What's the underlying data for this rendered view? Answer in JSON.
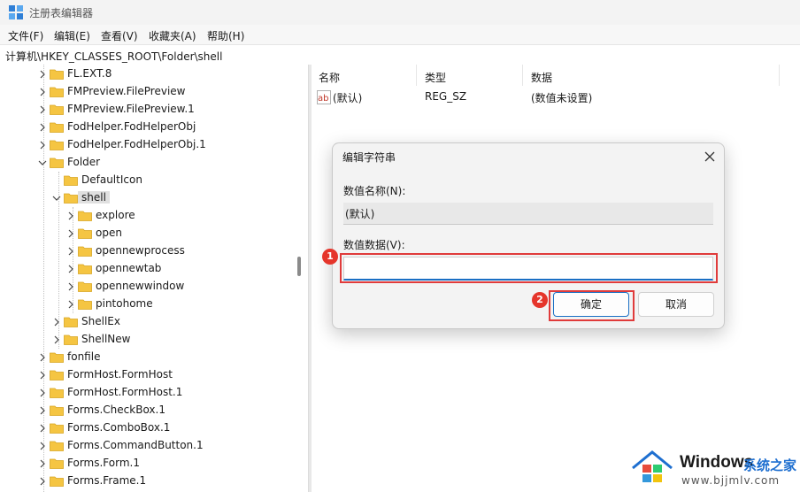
{
  "window": {
    "title": "注册表编辑器"
  },
  "menu": [
    {
      "id": "file",
      "label": "文件(F)"
    },
    {
      "id": "edit",
      "label": "编辑(E)"
    },
    {
      "id": "view",
      "label": "查看(V)"
    },
    {
      "id": "favorites",
      "label": "收藏夹(A)"
    },
    {
      "id": "help",
      "label": "帮助(H)"
    }
  ],
  "address": {
    "path": "计算机\\HKEY_CLASSES_ROOT\\Folder\\shell"
  },
  "tree": {
    "items": [
      {
        "label": "FL.EXT.8",
        "state": "collapsed"
      },
      {
        "label": "FMPreview.FilePreview",
        "state": "collapsed"
      },
      {
        "label": "FMPreview.FilePreview.1",
        "state": "collapsed"
      },
      {
        "label": "FodHelper.FodHelperObj",
        "state": "collapsed"
      },
      {
        "label": "FodHelper.FodHelperObj.1",
        "state": "collapsed"
      },
      {
        "label": "Folder",
        "state": "expanded"
      },
      {
        "label": "DefaultIcon",
        "state": "leaf"
      },
      {
        "label": "shell",
        "state": "expanded",
        "selected": true
      },
      {
        "label": "explore",
        "state": "collapsed"
      },
      {
        "label": "open",
        "state": "collapsed"
      },
      {
        "label": "opennewprocess",
        "state": "collapsed"
      },
      {
        "label": "opennewtab",
        "state": "collapsed"
      },
      {
        "label": "opennewwindow",
        "state": "collapsed"
      },
      {
        "label": "pintohome",
        "state": "collapsed"
      },
      {
        "label": "ShellEx",
        "state": "collapsed"
      },
      {
        "label": "ShellNew",
        "state": "collapsed"
      },
      {
        "label": "fonfile",
        "state": "collapsed"
      },
      {
        "label": "FormHost.FormHost",
        "state": "collapsed"
      },
      {
        "label": "FormHost.FormHost.1",
        "state": "collapsed"
      },
      {
        "label": "Forms.CheckBox.1",
        "state": "collapsed"
      },
      {
        "label": "Forms.ComboBox.1",
        "state": "collapsed"
      },
      {
        "label": "Forms.CommandButton.1",
        "state": "collapsed"
      },
      {
        "label": "Forms.Form.1",
        "state": "collapsed"
      },
      {
        "label": "Forms.Frame.1",
        "state": "collapsed"
      }
    ]
  },
  "values": {
    "headers": {
      "name": "名称",
      "type": "类型",
      "data": "数据"
    },
    "rows": [
      {
        "name": "(默认)",
        "type": "REG_SZ",
        "data": "(数值未设置)"
      }
    ]
  },
  "dialog": {
    "title": "编辑字符串",
    "name_label": "数值名称(N):",
    "name_value": "(默认)",
    "data_label": "数值数据(V):",
    "data_value": "",
    "ok": "确定",
    "cancel": "取消",
    "badges": [
      "1",
      "2"
    ]
  },
  "watermark": {
    "brand": "Windows",
    "site_cn": "系统之家",
    "url": "www.bjjmlv.com"
  },
  "colors": {
    "highlight_red": "#e03b3b",
    "badge_red": "#e5352b",
    "folder_yellow": "#f5c542",
    "accent_blue": "#1a6fc4"
  }
}
